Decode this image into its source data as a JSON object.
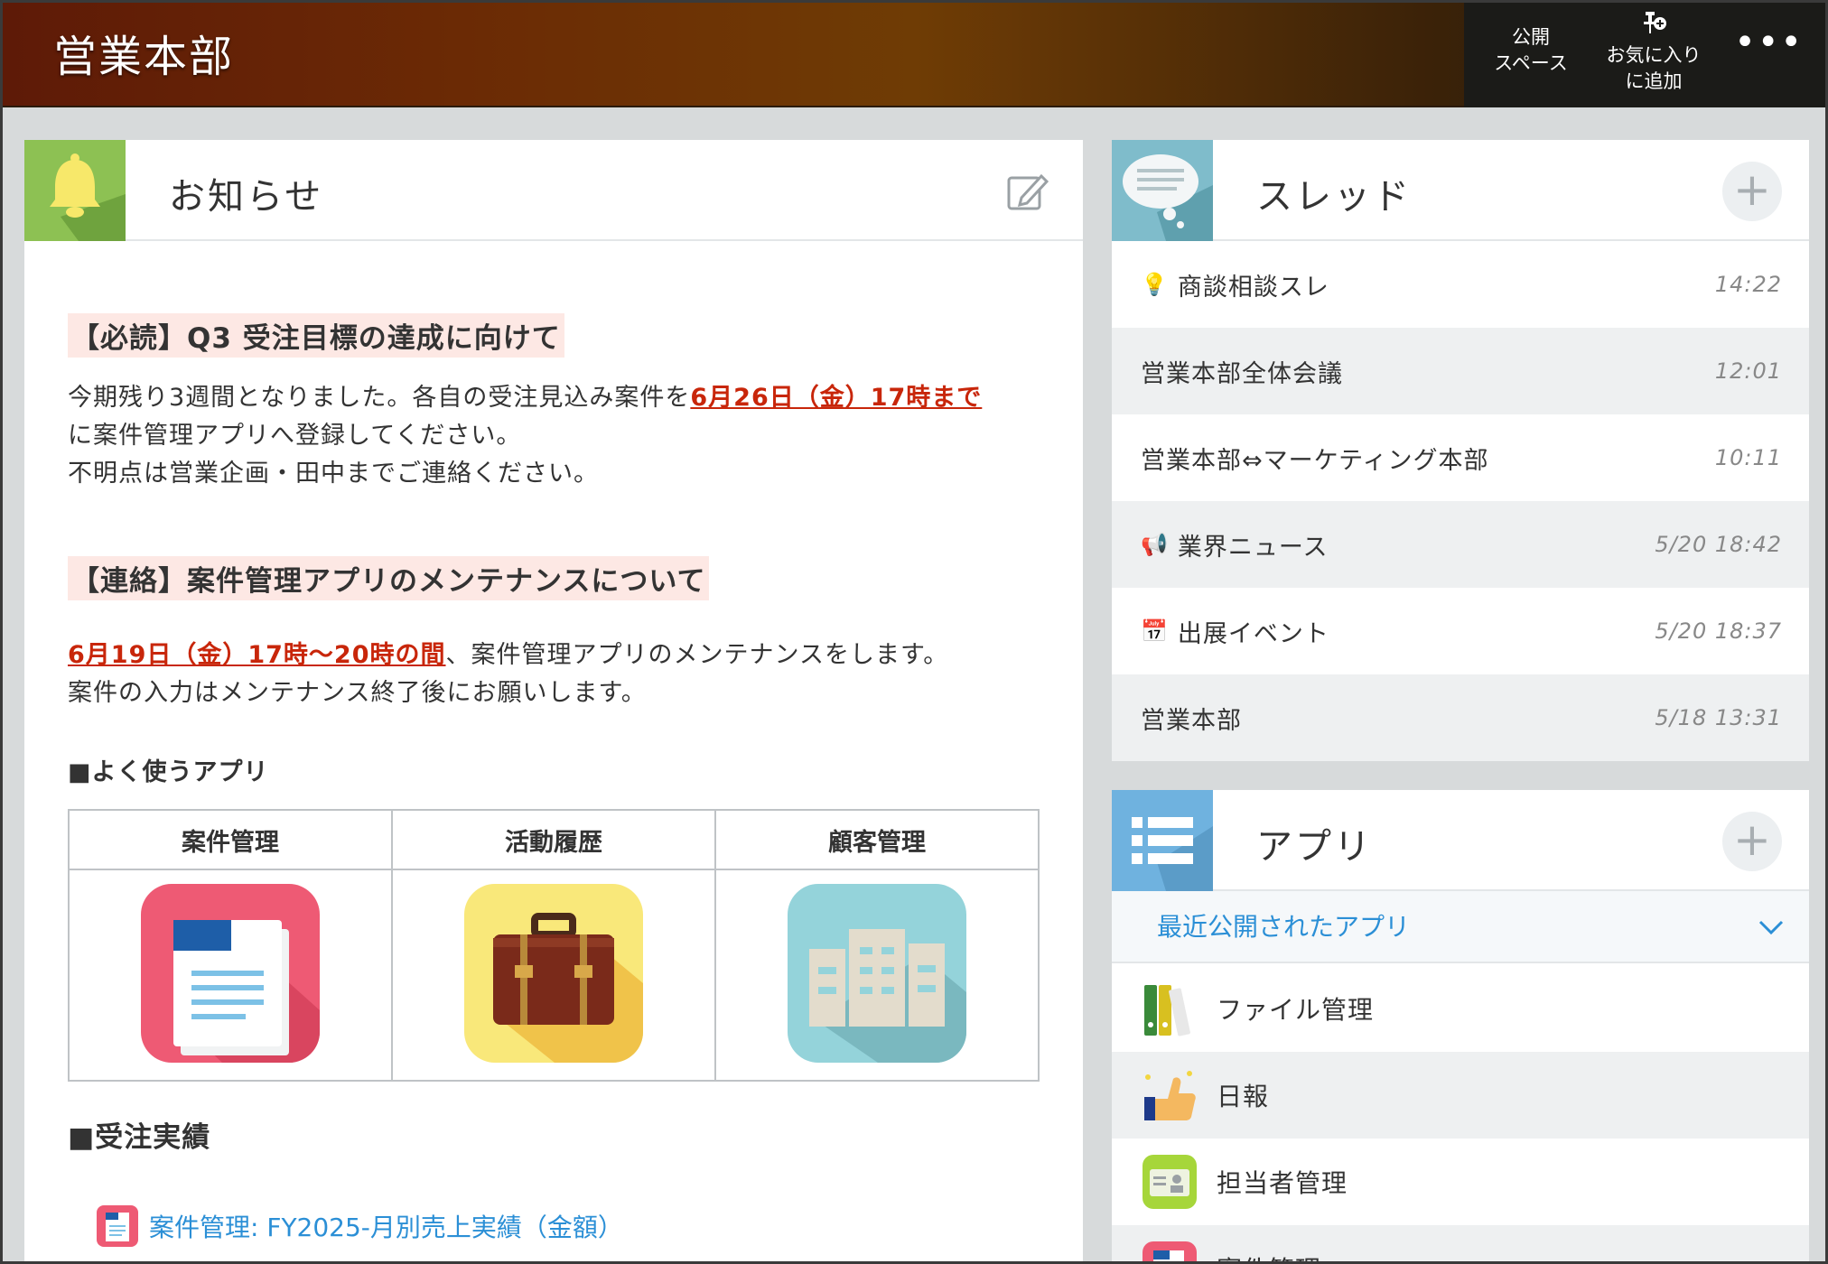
{
  "header": {
    "title": "営業本部",
    "public_space_label": "公開\nスペース",
    "favorite_label": "お気に入り\nに追加",
    "more_label": "•••"
  },
  "notice": {
    "title": "お知らせ",
    "item1": {
      "heading": "【必読】Q3 受注目標の達成に向けて",
      "text_before": "今期残り3週間となりました。各自の受注見込み案件を",
      "deadline": "6月26日（金）17時まで",
      "text_after": "に案件管理アプリへ登録してください。",
      "line3": "不明点は営業企画・田中までご連絡ください。"
    },
    "item2": {
      "heading": "【連絡】案件管理アプリのメンテナンスについて",
      "schedule": "6月19日（金）17時〜20時の間",
      "text_after": "、案件管理アプリのメンテナンスをします。",
      "line2": "案件の入力はメンテナンス終了後にお願いします。"
    },
    "apps_heading": "■よく使うアプリ",
    "apps_table": {
      "headers": [
        "案件管理",
        "活動履歴",
        "顧客管理"
      ]
    },
    "orders_heading": "■受注実績",
    "report_link": "案件管理: FY2025-月別売上実績（金額）"
  },
  "threads": {
    "title": "スレッド",
    "items": [
      {
        "icon": "💡",
        "name": "商談相談スレ",
        "time": "14:22"
      },
      {
        "icon": "",
        "name": "営業本部全体会議",
        "time": "12:01"
      },
      {
        "icon": "",
        "name": "営業本部⇔マーケティング本部",
        "time": "10:11"
      },
      {
        "icon": "📢",
        "name": "業界ニュース",
        "time": "5/20 18:42"
      },
      {
        "icon": "📅",
        "name": "出展イベント",
        "time": "5/20 18:37"
      },
      {
        "icon": "",
        "name": "営業本部",
        "time": "5/18 13:31"
      }
    ]
  },
  "apps": {
    "title": "アプリ",
    "recent_label": "最近公開されたアプリ",
    "items": [
      {
        "name": "ファイル管理"
      },
      {
        "name": "日報"
      },
      {
        "name": "担当者管理"
      },
      {
        "name": "案件管理"
      }
    ]
  },
  "colors": {
    "accent_red": "#c8260a",
    "link_blue": "#2b8fd6",
    "notice_icon_bg": "#8dc153",
    "threads_icon_bg": "#7fbccb",
    "apps_icon_bg": "#6fb2df"
  }
}
